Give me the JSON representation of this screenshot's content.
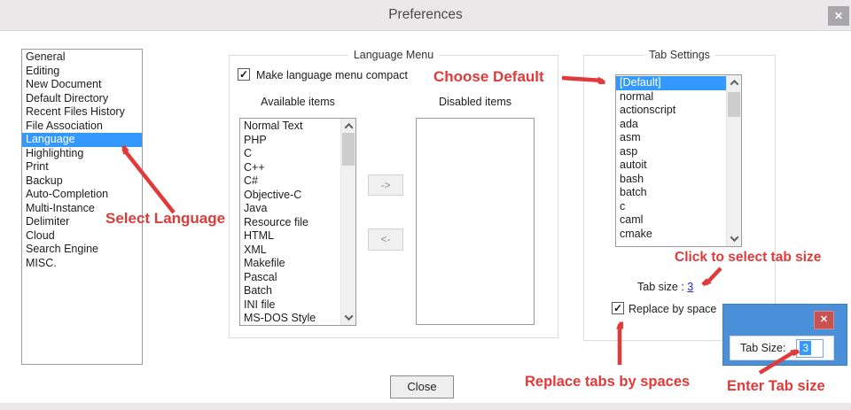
{
  "window": {
    "title": "Preferences"
  },
  "icons": {
    "close": "✕",
    "checkmark": "✓"
  },
  "sidebar": {
    "items": [
      "General",
      "Editing",
      "New Document",
      "Default Directory",
      "Recent Files History",
      "File Association",
      "Language",
      "Highlighting",
      "Print",
      "Backup",
      "Auto-Completion",
      "Multi-Instance",
      "Delimiter",
      "Cloud",
      "Search Engine",
      "MISC."
    ],
    "selected": "Language"
  },
  "language_menu": {
    "legend": "Language Menu",
    "compact_checkbox": {
      "label": "Make language menu compact",
      "checked": true
    },
    "available_label": "Available items",
    "disabled_label": "Disabled items",
    "available_items": [
      "Normal Text",
      "PHP",
      "C",
      "C++",
      "C#",
      "Objective-C",
      "Java",
      "Resource file",
      "HTML",
      "XML",
      "Makefile",
      "Pascal",
      "Batch",
      "INI file",
      "MS-DOS Style"
    ],
    "disabled_items": [],
    "move_right_label": "->",
    "move_left_label": "<-"
  },
  "tab_settings": {
    "legend": "Tab Settings",
    "items": [
      "[Default]",
      "normal",
      "actionscript",
      "ada",
      "asm",
      "asp",
      "autoit",
      "bash",
      "batch",
      "c",
      "caml",
      "cmake"
    ],
    "selected": "[Default]",
    "tab_size_label": "Tab size :",
    "tab_size_value": "3",
    "replace_checkbox": {
      "label": "Replace by space",
      "checked": true
    }
  },
  "overlay_dialog": {
    "field_label": "Tab Size:",
    "field_value": "3"
  },
  "footer": {
    "close_button": "Close"
  },
  "annotations": {
    "select_language": "Select Language",
    "choose_default": "Choose Default",
    "click_tab_size": "Click to select tab size",
    "replace_tabs": "Replace tabs by spaces",
    "enter_tab_size": "Enter Tab size"
  },
  "colors": {
    "selection_blue": "#3399ff",
    "annotation_red": "#e03a3a",
    "overlay_blue": "#4a90d8",
    "overlay_close_red": "#c9514f",
    "link_blue": "#2323cc",
    "titlebar_gray": "#eae8e9"
  }
}
